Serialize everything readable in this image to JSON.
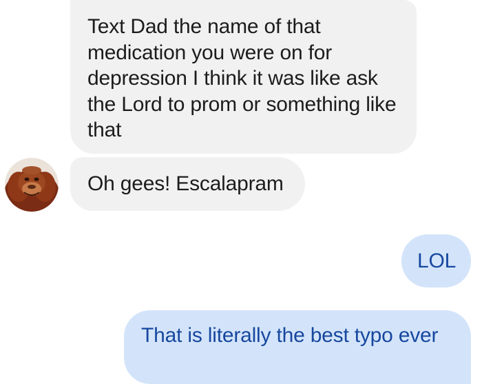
{
  "conversation": {
    "messages": [
      {
        "direction": "incoming",
        "text": "Text Dad the name of that medication you were on for depression I think it was like ask the Lord to prom or something like that"
      },
      {
        "direction": "incoming",
        "text": "Oh gees! Escalapram"
      },
      {
        "direction": "outgoing",
        "text": "LOL"
      },
      {
        "direction": "outgoing",
        "text": "That is literally the best typo ever"
      }
    ],
    "avatar": {
      "icon": "orangutan-avatar"
    }
  },
  "colors": {
    "incoming_bubble": "#f1f1f2",
    "incoming_text": "#1c1c1c",
    "outgoing_bubble": "#d3e4fa",
    "outgoing_text": "#17479e"
  }
}
